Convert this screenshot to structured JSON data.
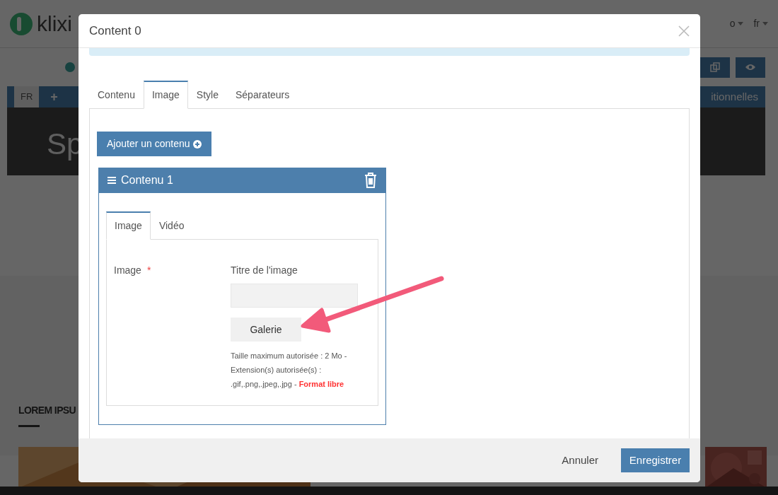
{
  "background": {
    "logo_text": "klixi",
    "user_menu": "o",
    "language_menu": "fr",
    "language_tab": "FR",
    "add_tab": "+",
    "banner_title": "Sp",
    "tab_label": "itionnelles",
    "section_title": "LOREM IPSU"
  },
  "modal": {
    "title": "Content 0",
    "tabs": [
      {
        "label": "Contenu",
        "selected": false
      },
      {
        "label": "Image",
        "selected": true
      },
      {
        "label": "Style",
        "selected": false
      },
      {
        "label": "Séparateurs",
        "selected": false
      }
    ],
    "add_button": "Ajouter un contenu",
    "panel": {
      "title": "Contenu 1",
      "tabs": [
        {
          "label": "Image",
          "selected": true
        },
        {
          "label": "Vidéo",
          "selected": false
        }
      ],
      "image_label": "Image",
      "required_mark": "*",
      "title_label": "Titre de l'image",
      "gallery_button": "Galerie",
      "help_text": "Taille maximum autorisée : 2 Mo - Extension(s) autorisée(s) : .gif,.png,.jpeg,.jpg - **Format libre**"
    },
    "buttons": {
      "cancel": "Annuler",
      "save": "Enregistrer"
    }
  }
}
